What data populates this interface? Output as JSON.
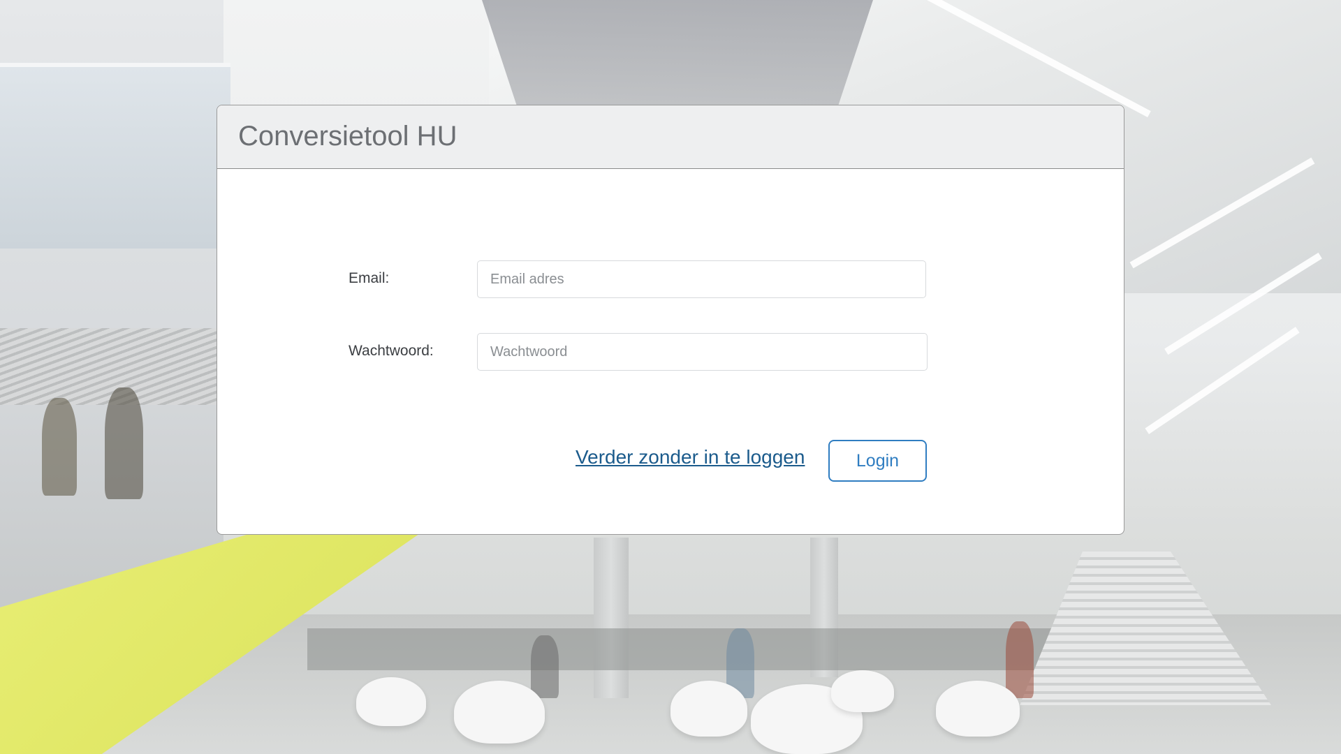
{
  "card": {
    "title": "Conversietool HU"
  },
  "form": {
    "email_label": "Email:",
    "email_placeholder": "Email adres",
    "email_value": "",
    "password_label": "Wachtwoord:",
    "password_placeholder": "Wachtwoord",
    "password_value": ""
  },
  "actions": {
    "skip_login_link": "Verder zonder in te loggen",
    "login_button": "Login"
  },
  "colors": {
    "primary": "#2f7dc1",
    "link": "#1b5b8c",
    "header_bg": "#eeeff0",
    "background_accent": "#e2e86c"
  }
}
